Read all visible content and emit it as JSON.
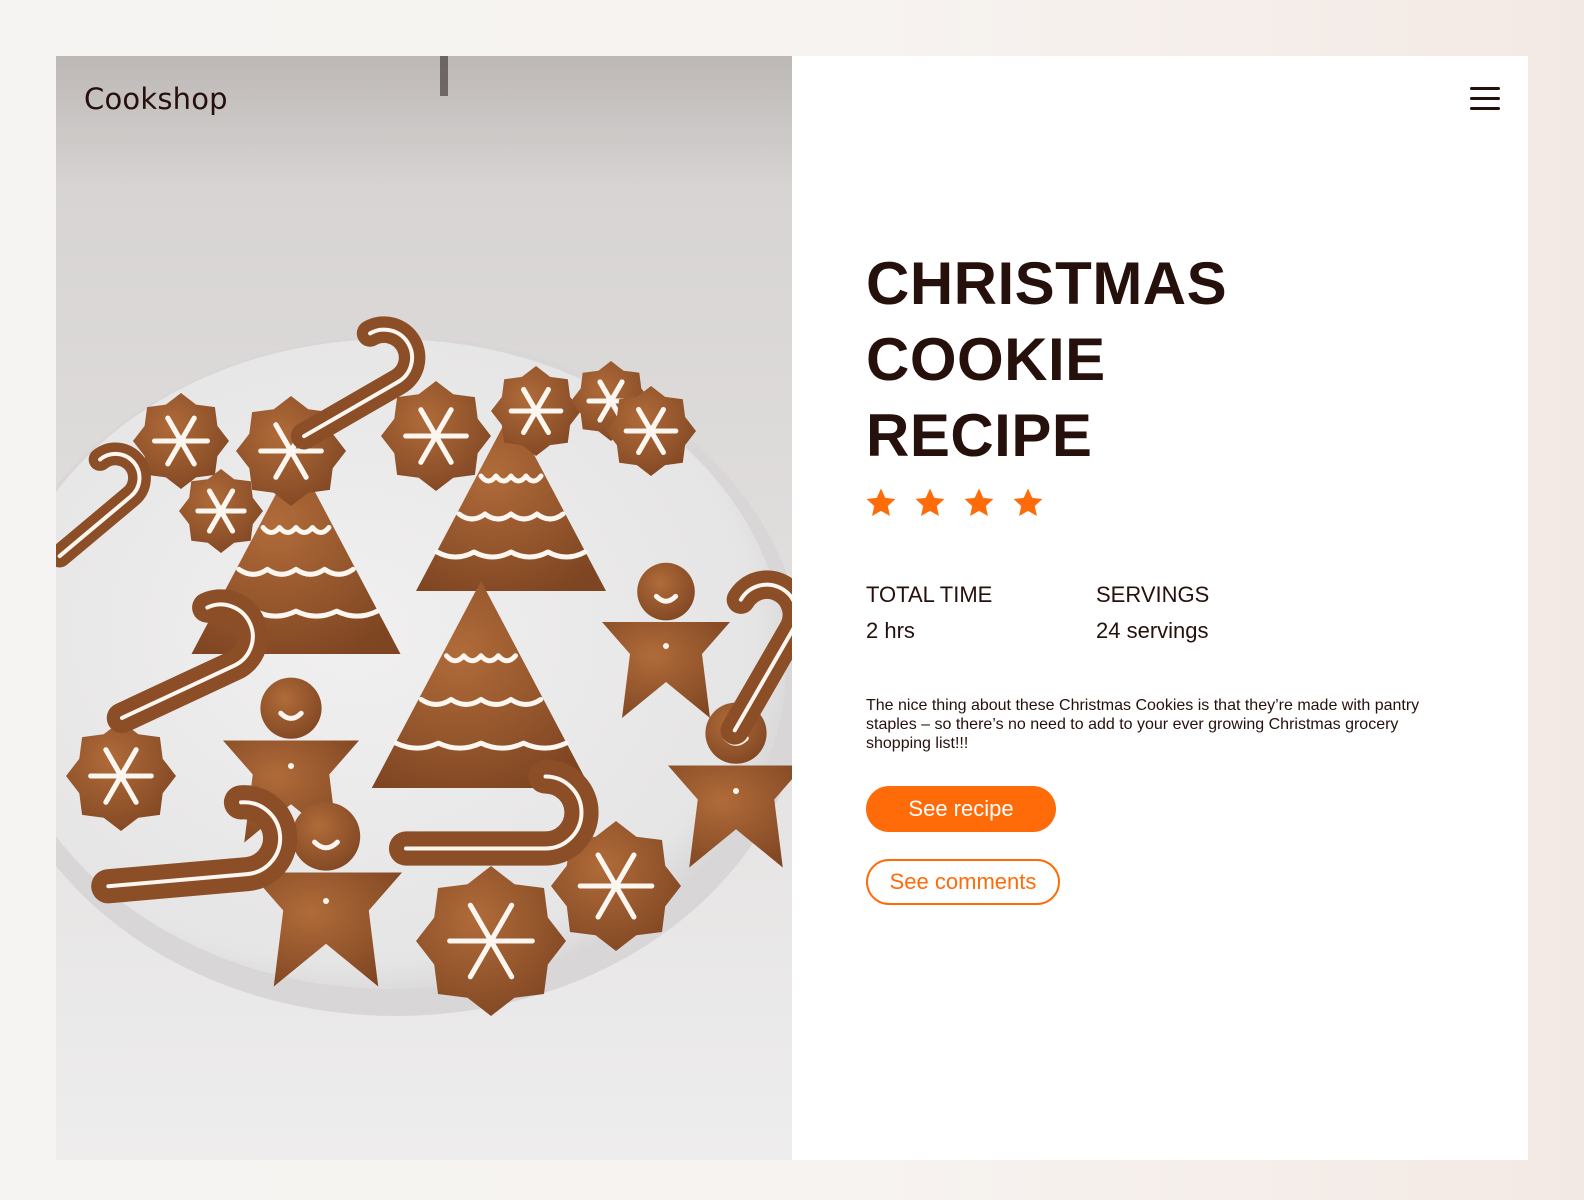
{
  "brand": {
    "name": "Cookshop"
  },
  "header": {
    "menu_icon": "hamburger-menu-icon"
  },
  "hero": {
    "image_icon": "gingerbread-cookies-photo",
    "title_lines": [
      "CHRISTMAS",
      "COOKIE",
      "RECIPE"
    ],
    "rating": {
      "stars": 4,
      "icon": "star-icon"
    },
    "meta": [
      {
        "label": "TOTAL TIME",
        "value": "2 hrs"
      },
      {
        "label": "SERVINGS",
        "value": "24 servings"
      }
    ],
    "description": "The nice thing about these Christmas Cookies is that they’re made with pantry staples – so there’s no need to add to your ever growing Christmas grocery shopping list!!!",
    "primary_button": "See recipe",
    "secondary_button": "See comments"
  },
  "colors": {
    "accent": "#ff6b08",
    "text": "#26100c",
    "cookie": "#9c5a2e",
    "icing": "#fbf6ef"
  }
}
